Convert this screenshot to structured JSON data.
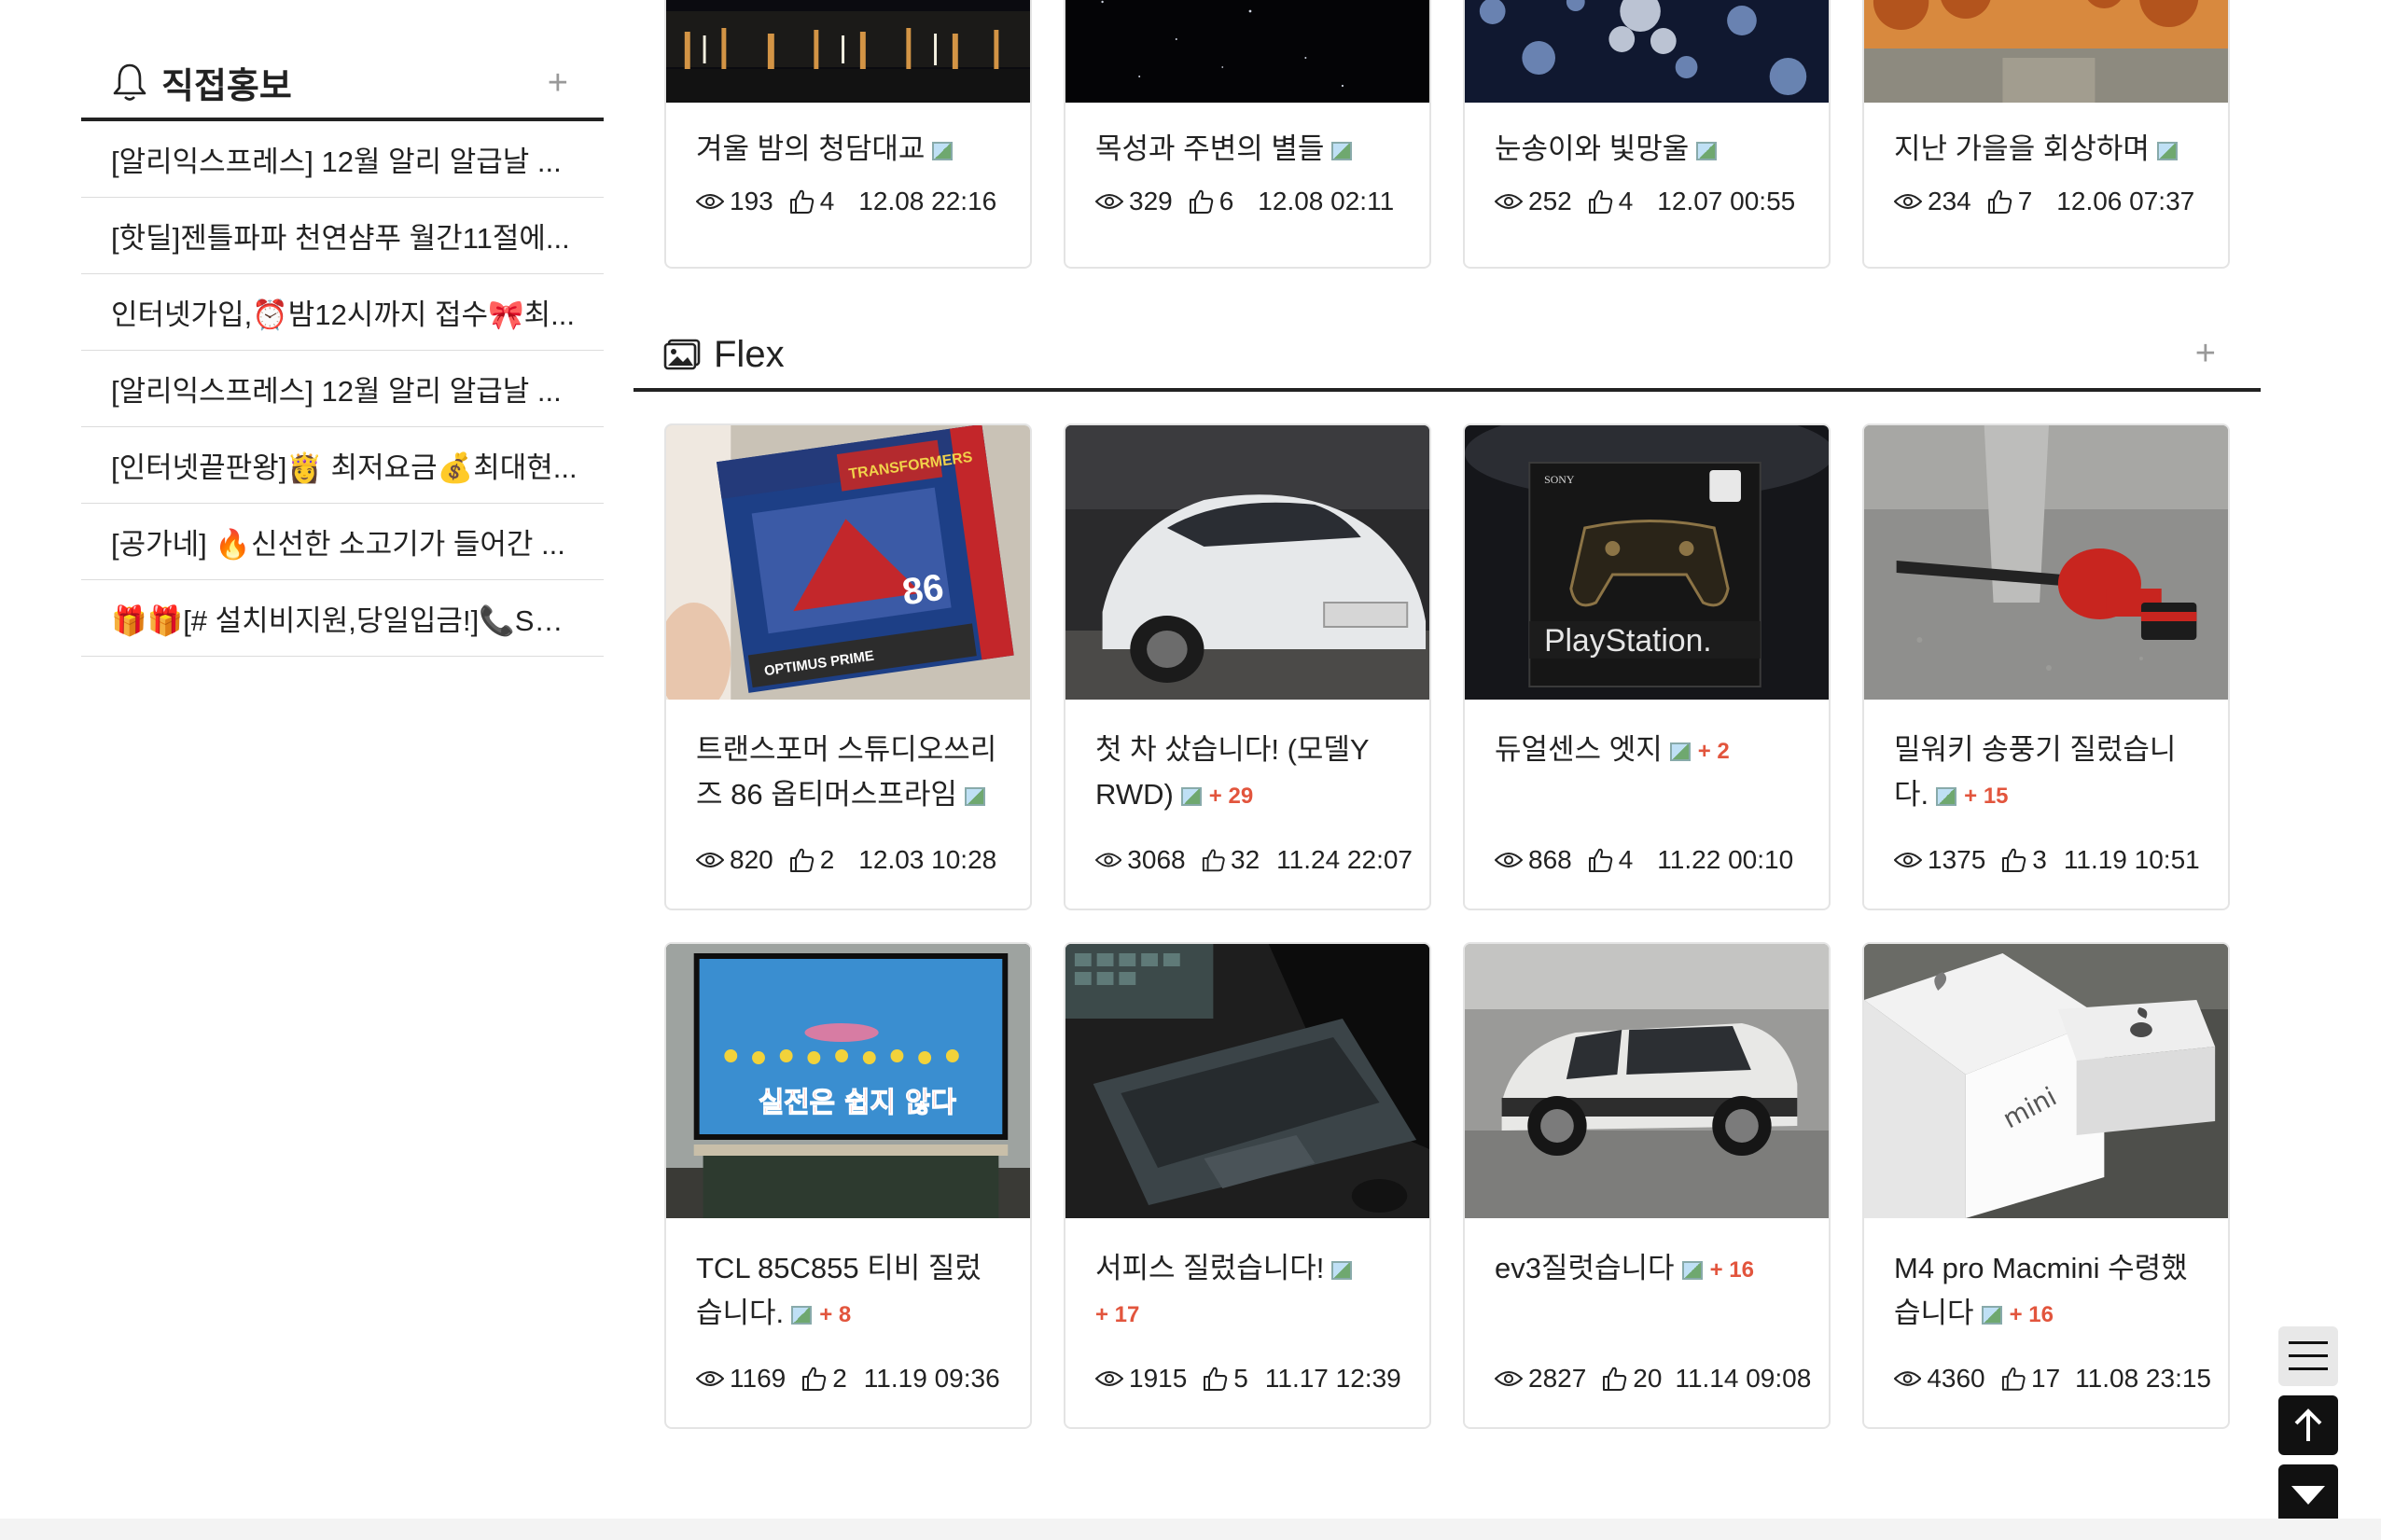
{
  "sidebar": {
    "title": "직접홍보",
    "plus": "+",
    "items": [
      {
        "label": "[알리익스프레스] 12월 알리 알급날 ..."
      },
      {
        "label": "[핫딜]젠틀파파 천연샴푸 월간11절에..."
      },
      {
        "label": "인터넷가입,⏰밤12시까지 접수🎀최..."
      },
      {
        "label": "[알리익스프레스] 12월 알리 알급날 ..."
      },
      {
        "label": "[인터넷끝판왕]👸 최저요금💰최대현..."
      },
      {
        "label": "[공가네] 🔥신선한 소고기가 들어간 ..."
      },
      {
        "label": "🎁🎁[# 설치비지원,당일입금!]📞SK/..."
      }
    ]
  },
  "top_row": [
    {
      "title": "겨울 밤의 청담대교",
      "views": "193",
      "likes": "4",
      "date": "12.08 22:16"
    },
    {
      "title": "목성과 주변의 별들",
      "views": "329",
      "likes": "6",
      "date": "12.08 02:11"
    },
    {
      "title": "눈송이와 빛망울",
      "views": "252",
      "likes": "4",
      "date": "12.07 00:55"
    },
    {
      "title": "지난 가을을 회상하며",
      "views": "234",
      "likes": "7",
      "date": "12.06 07:37"
    }
  ],
  "section": {
    "title": "Flex",
    "plus": "+"
  },
  "flex_row1": [
    {
      "title_line1": "트랜스포머 스튜디오쓰리",
      "title_line2": "즈 86 옵티머스프라임",
      "count": "",
      "views": "820",
      "likes": "2",
      "date": "12.03 10:28"
    },
    {
      "title_line1": "첫 차 샀습니다! (모델Y",
      "title_line2": "RWD)",
      "count": "+ 29",
      "views": "3068",
      "likes": "32",
      "date": "11.24 22:07"
    },
    {
      "title_line1": "듀얼센스 엣지",
      "title_line2": "",
      "count": "+ 2",
      "views": "868",
      "likes": "4",
      "date": "11.22 00:10"
    },
    {
      "title_line1": "밀워키 송풍기 질렀습니",
      "title_line2": "다.",
      "count": "+ 15",
      "views": "1375",
      "likes": "3",
      "date": "11.19 10:51"
    }
  ],
  "flex_row2": [
    {
      "title_line1": "TCL 85C855 티비 질렀",
      "title_line2": "습니다.",
      "count": "+ 8",
      "views": "1169",
      "likes": "2",
      "date": "11.19 09:36"
    },
    {
      "title_line1": "서피스 질렀습니다!",
      "title_line2": "",
      "count": "+ 17",
      "views": "1915",
      "likes": "5",
      "date": "11.17 12:39"
    },
    {
      "title_line1": "ev3질럿습니다",
      "title_line2": "",
      "count": "+ 16",
      "views": "2827",
      "likes": "20",
      "date": "11.14 09:08"
    },
    {
      "title_line1": "M4 pro Macmini 수령했",
      "title_line2": "습니다",
      "count": "+ 16",
      "views": "4360",
      "likes": "17",
      "date": "11.08 23:15"
    }
  ],
  "thumb_texts": {
    "tf_box": "OPTIMUS PRIME",
    "tf_brand": "TRANSFORMERS",
    "tf_number": "86",
    "ps_sony": "SONY",
    "ps_brand": "PlayStation.",
    "tv_caption": "실전은 쉽지 않다",
    "mac_mini": "mini"
  },
  "colors": {
    "accent_count": "#e2553d",
    "border": "#e4e4e4",
    "rule": "#222222"
  }
}
